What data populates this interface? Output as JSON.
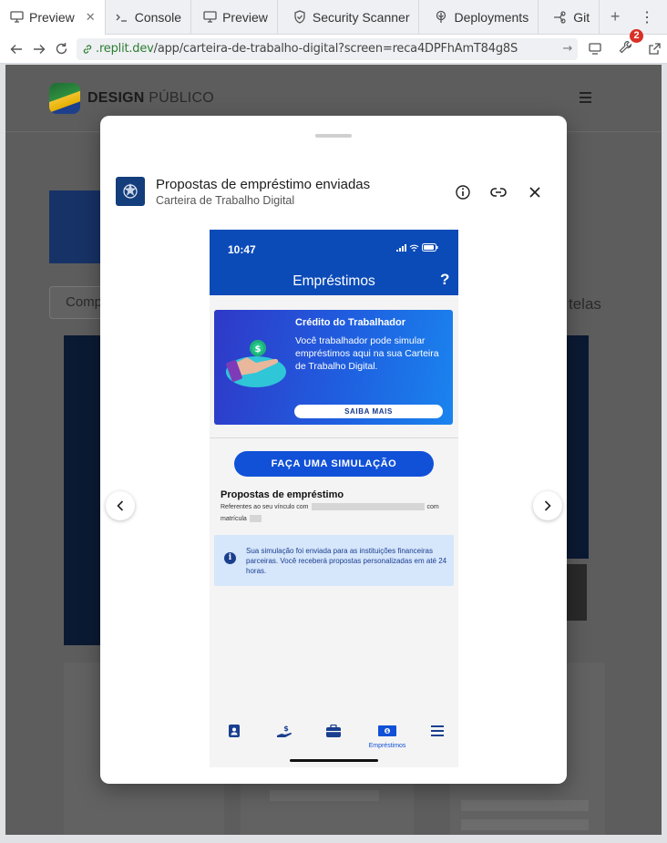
{
  "browser": {
    "tabs": [
      {
        "label": "Preview",
        "icon": "monitor-icon",
        "active": true,
        "closable": true
      },
      {
        "label": "Console",
        "icon": "terminal-icon"
      },
      {
        "label": "Preview",
        "icon": "monitor-icon"
      },
      {
        "label": "Security Scanner",
        "icon": "shield-icon"
      },
      {
        "label": "Deployments",
        "icon": "deployments-icon"
      },
      {
        "label": "Git",
        "icon": "git-icon"
      }
    ],
    "url_host": ".replit.dev",
    "url_path": "/app/carteira-de-trabalho-digital?screen=reca4DPFhAmT84g8S",
    "notification_count": "2"
  },
  "site": {
    "logo_bold": "DESIGN",
    "logo_light": "PÚBLICO",
    "bg_input_text": "Comp",
    "bg_telas_text": "telas"
  },
  "modal": {
    "title": "Propostas de empréstimo enviadas",
    "subtitle": "Carteira de Trabalho Digital"
  },
  "phone": {
    "time": "10:47",
    "header_title": "Empréstimos",
    "help": "?",
    "promo": {
      "title": "Crédito do Trabalhador",
      "text": "Você trabalhador pode simular empréstimos aqui na sua Carteira de Trabalho Digital.",
      "button": "SAIBA MAIS"
    },
    "simulate_button": "FAÇA UMA SIMULAÇÃO",
    "proposals": {
      "title": "Propostas de empréstimo",
      "line1_prefix": "Referentes ao seu vínculo com",
      "line1_suffix": "com",
      "line2_prefix": "matrícula"
    },
    "info_text": "Sua simulação foi enviada para as instituições financeiras parceiras. Você receberá propostas personalizadas em até 24 horas.",
    "tab_active_label": "Empréstimos"
  },
  "colors": {
    "brand_blue": "#0b4bb8",
    "button_blue": "#1151d8",
    "info_bg": "#d6e6fb",
    "url_host_green": "#2e7d32"
  }
}
